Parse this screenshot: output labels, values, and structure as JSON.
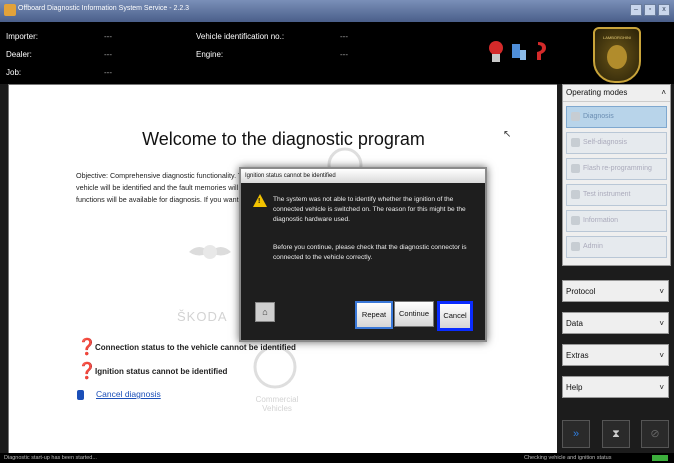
{
  "window": {
    "title": "Offboard Diagnostic Information System Service - 2.2.3",
    "buttons": [
      "–",
      "▫",
      "x"
    ]
  },
  "info": {
    "importer_label": "Importer:",
    "importer_value": "---",
    "dealer_label": "Dealer:",
    "dealer_value": "---",
    "job_label": "Job:",
    "job_value": "---",
    "vin_label": "Vehicle identification no.:",
    "vin_value": "---",
    "engine_label": "Engine:",
    "engine_value": "---"
  },
  "logo_text": "LAMBORGHINI",
  "main": {
    "welcome": "Welcome to the diagnostic program",
    "objective_line1": "Objective: Comprehensive diagnostic functionality. The vehicle system will be identified and the diagnostic list will be created.",
    "objective_line2": "vehicle will be identified and the fault memories will be interrogated; after that the \"Test plan\" and \"Special functions\"",
    "objective_line3": "functions will be available for diagnosis. If you want to continue, select the corresponding function in the diagnosis.",
    "brand_skoda": "ŠKODA",
    "brand_commercial": "Commercial\nVehicles",
    "connection_status": "Connection status to the vehicle cannot be identified",
    "ignition_status": "Ignition status cannot be identified",
    "cancel_diagnosis": "Cancel diagnosis"
  },
  "sidebar": {
    "operating_modes_label": "Operating modes",
    "modes": [
      "Diagnosis",
      "Self-diagnosis",
      "Flash re-programming",
      "Test instrument",
      "Information",
      "Admin"
    ],
    "protocol_label": "Protocol",
    "data_label": "Data",
    "extras_label": "Extras",
    "help_label": "Help"
  },
  "dialog": {
    "title": "Ignition status cannot be identified",
    "message1": "The system was not able to identify whether the ignition of the connected vehicle is switched on. The reason for this might be the diagnostic hardware used.",
    "message2": "Before you continue, please check that the diagnostic connector is connected to the vehicle correctly.",
    "repeat_label": "Repeat",
    "continue_label": "Continue",
    "cancel_label": "Cancel"
  },
  "statusbar": {
    "left": "Diagnostic start-up has been started...",
    "right": "Checking vehicle and ignition status"
  },
  "colors": {
    "background": "#000000",
    "accent_blue": "#0a2cff",
    "warning": "#f2c200",
    "status_green": "#3cae3c"
  }
}
